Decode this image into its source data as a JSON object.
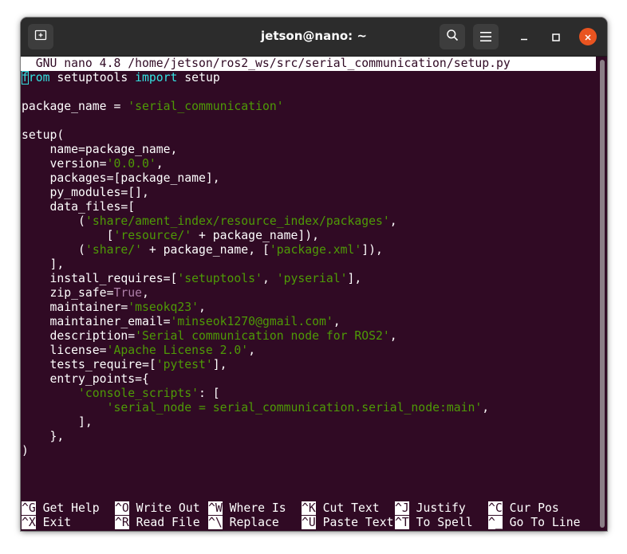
{
  "window": {
    "title": "jetson@nano: ~"
  },
  "icons": {
    "new_tab": "new-tab-icon",
    "search": "search-icon",
    "menu": "hamburger-menu-icon",
    "minimize": "minimize-icon",
    "maximize": "maximize-icon",
    "close": "close-icon"
  },
  "colors": {
    "terminal_bg": "#300a24",
    "keyword": "#34e2e2",
    "string": "#4e9a06",
    "constant": "#ad7fa8",
    "close_button": "#e95420"
  },
  "nano": {
    "header": "  GNU nano 4.8 /home/jetson/ros2_ws/src/serial_communication/setup.py",
    "code": {
      "l1_kw_from_rest": "rom",
      "l1_kw_from_first": "f",
      "l1_plain_a": " setuptools ",
      "l1_kw_import": "import",
      "l1_plain_b": " setup",
      "l3_plain": "package_name = ",
      "l3_str": "'serial_communication'",
      "l5_plain": "setup(",
      "l6_plain": "    name=package_name,",
      "l7_plain_a": "    version=",
      "l7_str": "'0.0.0'",
      "l7_plain_b": ",",
      "l8_plain": "    packages=[package_name],",
      "l9_plain": "    py_modules=[],",
      "l10_plain": "    data_files=[",
      "l11_plain_a": "        (",
      "l11_str": "'share/ament_index/resource_index/packages'",
      "l11_plain_b": ",",
      "l12_plain_a": "            [",
      "l12_str": "'resource/'",
      "l12_plain_b": " + package_name]),",
      "l13_plain_a": "        (",
      "l13_str_a": "'share/'",
      "l13_plain_b": " + package_name, [",
      "l13_str_b": "'package.xml'",
      "l13_plain_c": "]),",
      "l14_plain": "    ],",
      "l15_plain_a": "    install_requires=[",
      "l15_str_a": "'setuptools'",
      "l15_plain_b": ", ",
      "l15_str_b": "'pyserial'",
      "l15_plain_c": "],",
      "l16_plain_a": "    zip_safe=",
      "l16_con": "True",
      "l16_plain_b": ",",
      "l17_plain_a": "    maintainer=",
      "l17_str": "'mseokq23'",
      "l17_plain_b": ",",
      "l18_plain_a": "    maintainer_email=",
      "l18_str": "'minseok1270@gmail.com'",
      "l18_plain_b": ",",
      "l19_plain_a": "    description=",
      "l19_str": "'Serial communication node for ROS2'",
      "l19_plain_b": ",",
      "l20_plain_a": "    license=",
      "l20_str": "'Apache License 2.0'",
      "l20_plain_b": ",",
      "l21_plain_a": "    tests_require=[",
      "l21_str": "'pytest'",
      "l21_plain_b": "],",
      "l22_plain": "    entry_points={",
      "l23_plain_a": "        ",
      "l23_str": "'console_scripts'",
      "l23_plain_b": ": [",
      "l24_plain_a": "            ",
      "l24_str": "'serial_node = serial_communication.serial_node:main'",
      "l24_plain_b": ",",
      "l25_plain": "        ],",
      "l26_plain": "    },",
      "l27_plain": ")"
    },
    "shortcuts": [
      {
        "key": "^G",
        "label": " Get Help"
      },
      {
        "key": "^O",
        "label": " Write Out"
      },
      {
        "key": "^W",
        "label": " Where Is"
      },
      {
        "key": "^K",
        "label": " Cut Text"
      },
      {
        "key": "^J",
        "label": " Justify"
      },
      {
        "key": "^C",
        "label": " Cur Pos"
      },
      {
        "key": "^X",
        "label": " Exit"
      },
      {
        "key": "^R",
        "label": " Read File"
      },
      {
        "key": "^\\",
        "label": " Replace"
      },
      {
        "key": "^U",
        "label": " Paste Text"
      },
      {
        "key": "^T",
        "label": " To Spell"
      },
      {
        "key": "^_",
        "label": " Go To Line"
      }
    ]
  }
}
